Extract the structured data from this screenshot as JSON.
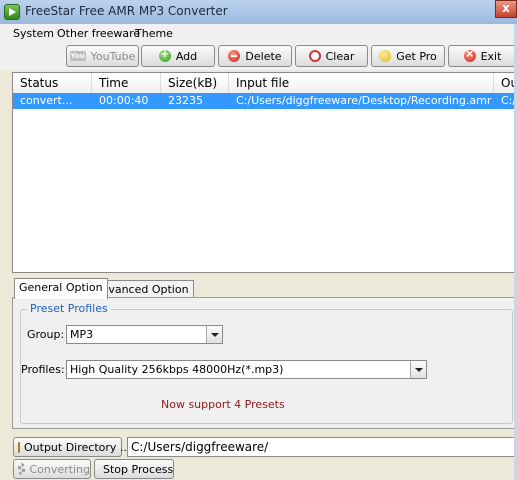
{
  "window": {
    "title": "FreeStar Free AMR MP3 Converter",
    "close_glyph": "x"
  },
  "menu": [
    "System",
    "Other freeware",
    "Theme"
  ],
  "toolbar": {
    "youtube": "YouTube",
    "youtube_logo": "You",
    "add": "Add",
    "delete": "Delete",
    "clear": "Clear",
    "get_pro": "Get Pro",
    "exit": "Exit"
  },
  "table": {
    "columns": [
      "Status",
      "Time",
      "Size(kB)",
      "Input file",
      "Out"
    ],
    "rows": [
      {
        "status": "convert...",
        "time": "00:00:40",
        "size": "23235",
        "input": "C:/Users/diggfreeware/Desktop/Recording.amr",
        "output": "C:/U"
      }
    ]
  },
  "tabs": [
    "General Option",
    "Advanced Option"
  ],
  "presets": {
    "group_title": "Preset Profiles",
    "group_label": "Group:",
    "group_value": "MP3",
    "profiles_label": "Profiles:",
    "profiles_value": "High Quality 256kbps 48000Hz(*.mp3)",
    "notice": "Now support 4 Presets"
  },
  "output": {
    "directory_button": "Output Directory ...",
    "path": "C:/Users/diggfreeware/"
  },
  "actions": {
    "converting": "Converting",
    "stop": "Stop Process"
  }
}
